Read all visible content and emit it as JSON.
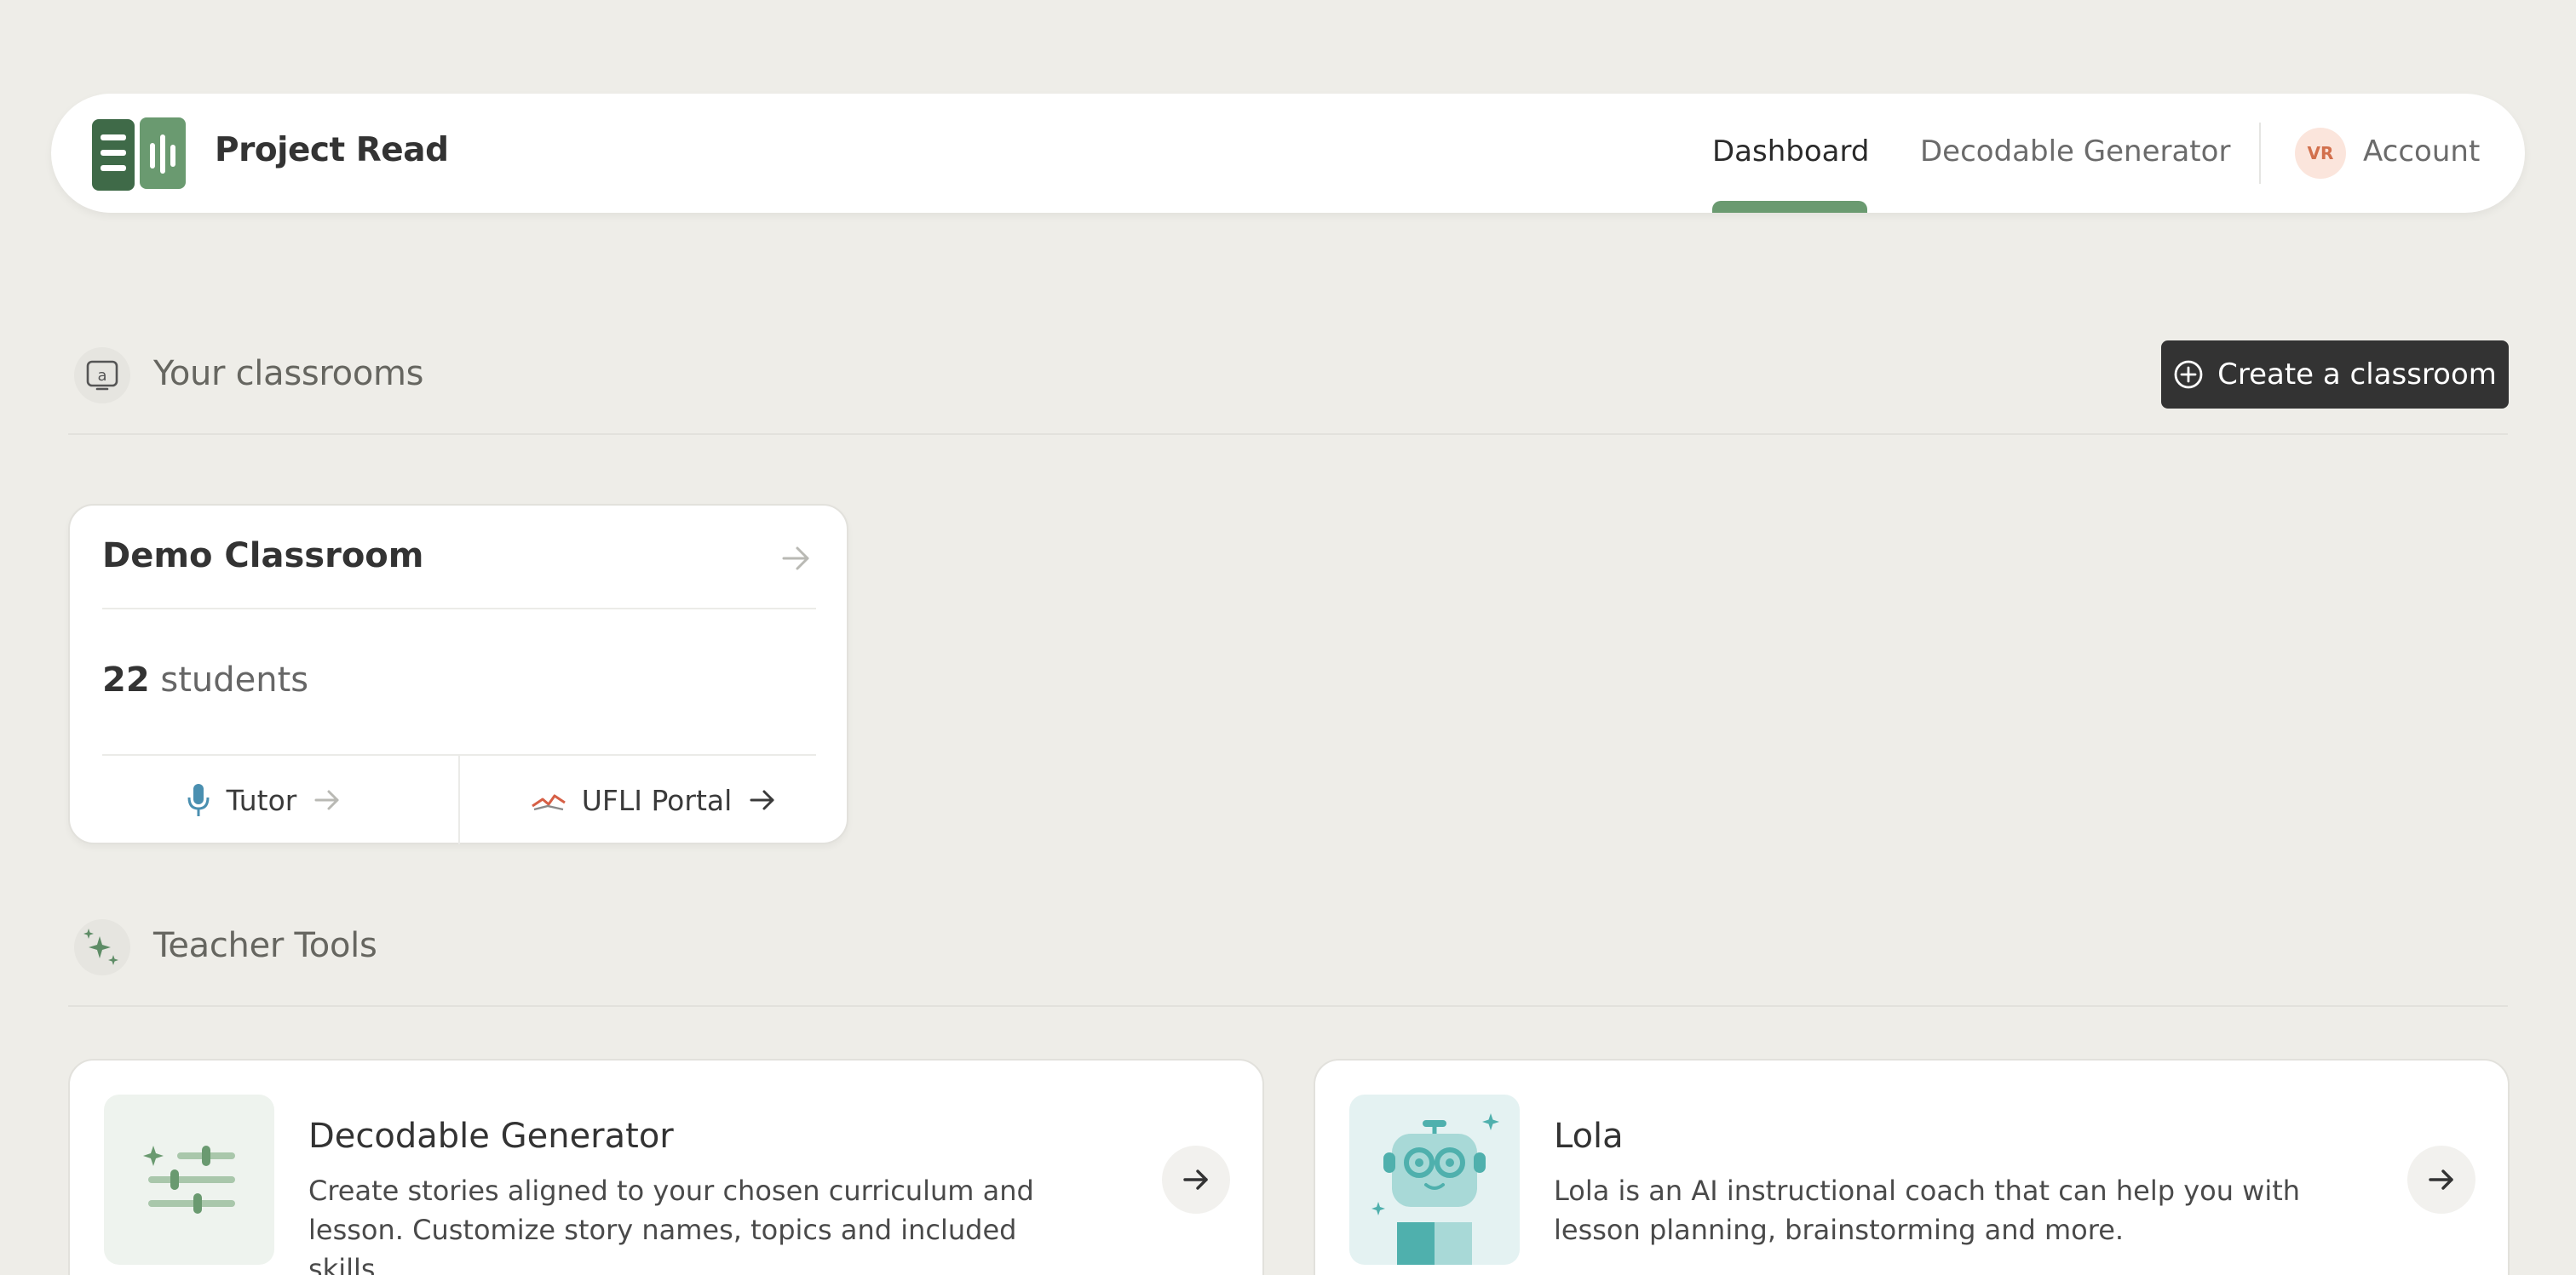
{
  "header": {
    "brand": "Project Read",
    "nav": {
      "dashboard": "Dashboard",
      "decodable": "Decodable Generator",
      "account": "Account"
    },
    "avatar_initials": "VR"
  },
  "classrooms": {
    "title": "Your classrooms",
    "create_label": "Create a classroom",
    "cards": [
      {
        "name": "Demo Classroom",
        "student_count": "22",
        "students_label": "students",
        "links": {
          "tutor": "Tutor",
          "ufli": "UFLI Portal"
        }
      }
    ]
  },
  "tools": {
    "title": "Teacher Tools",
    "items": [
      {
        "title": "Decodable Generator",
        "description": "Create stories aligned to your chosen curriculum and lesson. Customize story names, topics and included skills."
      },
      {
        "title": "Lola",
        "description": "Lola is an AI instructional coach that can help you with lesson planning, brainstorming and more."
      }
    ]
  },
  "colors": {
    "accent_green": "#6a9a70",
    "dark_button": "#333333",
    "avatar_bg": "#fbe5dc",
    "avatar_text": "#d2704d"
  }
}
